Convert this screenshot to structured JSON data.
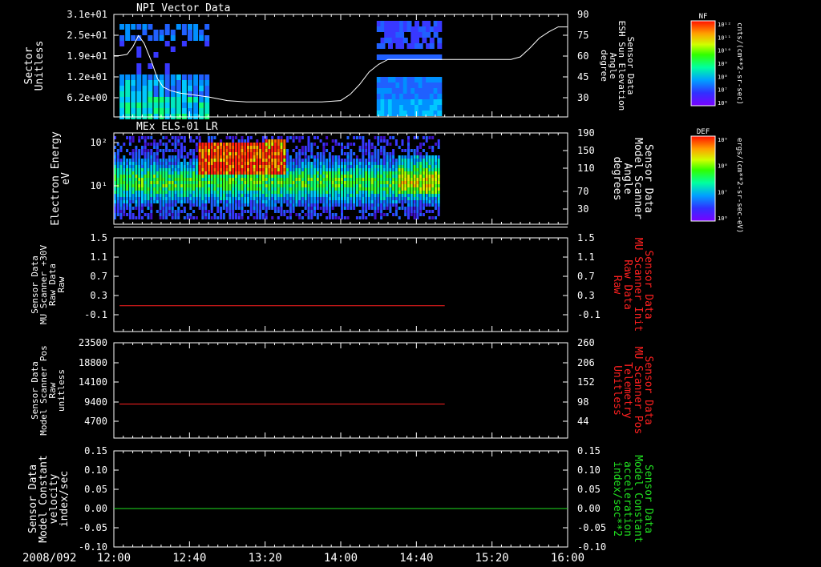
{
  "chart_data": {
    "type": "stacked-time-series",
    "date": "2008/092",
    "time_ticks": [
      "12:00",
      "12:40",
      "13:20",
      "14:00",
      "14:40",
      "15:20",
      "16:00"
    ],
    "time_range_minutes": [
      720,
      960
    ],
    "panels": [
      {
        "id": "npi",
        "type": "heatmap",
        "title": "NPI Vector Data",
        "left_label": [
          "Sector",
          "Unitless"
        ],
        "left_ticks": [
          "3.1e+01",
          "2.5e+01",
          "1.9e+01",
          "1.2e+01",
          "6.2e+00"
        ],
        "right_label": [
          "Sensor Data",
          "ESH Sun Elevation",
          "Angle",
          "degree"
        ],
        "right_label_color": "#ffffff",
        "right_ticks": [
          "90",
          "75",
          "60",
          "45",
          "30"
        ],
        "right_range": [
          15,
          90
        ],
        "data_gap_minutes": [
          [
            770,
            859
          ]
        ],
        "data_end_minute": 892,
        "overlay_line": {
          "color": "#ffffff",
          "t": [
            720,
            723,
            727,
            730,
            733,
            736,
            740,
            743,
            746,
            750,
            755,
            760,
            770,
            780,
            790,
            800,
            810,
            820,
            830,
            840,
            845,
            850,
            855,
            860,
            865,
            870,
            880,
            890,
            900,
            910,
            920,
            930,
            935,
            940,
            945,
            950,
            955,
            960
          ],
          "y": [
            57,
            57,
            58,
            64,
            73,
            67,
            52,
            39,
            32,
            29,
            27,
            26,
            24,
            21,
            20,
            20,
            20,
            20,
            20,
            21,
            26,
            34,
            44,
            50,
            54,
            54,
            54,
            54,
            54,
            54,
            54,
            54,
            56,
            63,
            71,
            76,
            80,
            80
          ]
        }
      },
      {
        "id": "els",
        "type": "heatmap",
        "title": "MEx ELS-01 LR",
        "left_label": [
          "Electron Energy",
          "eV"
        ],
        "left_ticks": [
          "10²",
          "10¹"
        ],
        "right_label": [
          "Sensor Data",
          "Model Scanner",
          "Angle",
          "degrees"
        ],
        "right_label_color": "#ffffff",
        "right_ticks": [
          "190",
          "150",
          "110",
          "70",
          "30"
        ],
        "right_range": [
          0,
          190
        ],
        "overlay_line": {
          "color": "#ffffff",
          "t": [
            720,
            960
          ],
          "y": [
            10,
            10
          ]
        },
        "data_end_minute": 892
      },
      {
        "id": "mu30v",
        "type": "line",
        "left_label": [
          "Sensor Data",
          "MU Scanner +30V",
          "Raw Data",
          "Raw"
        ],
        "left_ticks": [
          "1.5",
          "1.1",
          "0.7",
          "0.3",
          "-0.1"
        ],
        "left_range": [
          -0.5,
          1.5
        ],
        "right_label": [
          "Sensor Data",
          "MU Scanner Init",
          "Raw Data",
          "Raw"
        ],
        "right_label_color": "#ff2020",
        "right_ticks": [
          "1.5",
          "1.1",
          "0.7",
          "0.3",
          "-0.1"
        ],
        "series": [
          {
            "color": "#ff2020",
            "t": [
              723,
              895
            ],
            "y": [
              0.05,
              0.05
            ]
          }
        ]
      },
      {
        "id": "mupos",
        "type": "line",
        "left_label": [
          "Sensor Data",
          "Model Scanner Pos",
          "Raw",
          "unitless"
        ],
        "left_ticks": [
          "23500",
          "18800",
          "14100",
          "9400",
          "4700"
        ],
        "left_range": [
          0,
          23500
        ],
        "right_label": [
          "Sensor Data",
          "MU Scanner Pos",
          "Telemetry",
          "Unitless"
        ],
        "right_label_color": "#ff2020",
        "right_ticks": [
          "260",
          "206",
          "152",
          "98",
          "44"
        ],
        "series": [
          {
            "color": "#ff2020",
            "t": [
              723,
              895
            ],
            "y": [
              8400,
              8400
            ]
          }
        ]
      },
      {
        "id": "const",
        "type": "line",
        "left_label": [
          "Sensor Data",
          "Model Constant",
          "velocity",
          "index/sec"
        ],
        "left_ticks": [
          "0.15",
          "0.10",
          "0.05",
          "0.00",
          "-0.05",
          "-0.10"
        ],
        "left_range": [
          -0.1,
          0.15
        ],
        "right_label": [
          "Sensor Data",
          "Model Constant",
          "acceleration",
          "index/sec**2"
        ],
        "right_label_color": "#20e020",
        "right_ticks": [
          "0.15",
          "0.10",
          "0.05",
          "0.00",
          "-0.05",
          "-0.10"
        ],
        "series": [
          {
            "color": "#20e020",
            "t": [
              720,
              960
            ],
            "y": [
              0.0,
              0.0
            ]
          }
        ]
      }
    ],
    "colorbars": [
      {
        "id": "nf",
        "label": "NF",
        "ticks": [
          "10¹²",
          "10¹¹",
          "10¹⁰",
          "10⁹",
          "10⁸",
          "10⁷",
          "10⁶"
        ],
        "units": "cnts/(cm**2-sr-sec)"
      },
      {
        "id": "def",
        "label": "DEF",
        "ticks": [
          "10⁹",
          "10⁸",
          "10⁷",
          "10⁶"
        ],
        "units": "ergs/(cm**2-sr-sec-eV)"
      }
    ]
  }
}
